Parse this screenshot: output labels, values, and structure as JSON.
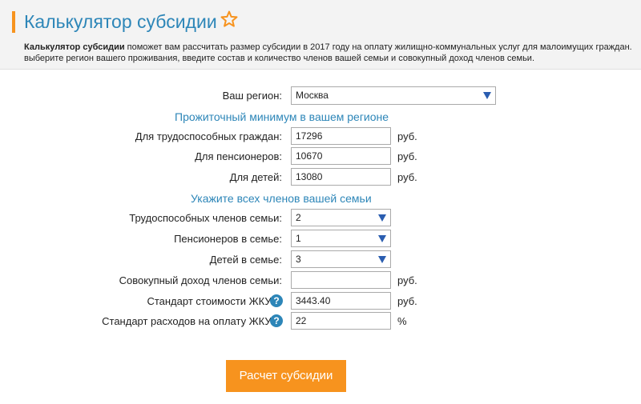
{
  "header": {
    "title": "Калькулятор субсидии",
    "desc_bold": "Калькулятор субсидии",
    "desc_line1_rest": " поможет вам рассчитать размер субсидии в 2017 году на оплату жилищно-коммунальных услуг для малоимущих граждан.",
    "desc_line2": "выберите регион вашего проживания, введите состав и количество членов вашей семьи и совокупный доход членов семьи."
  },
  "region": {
    "label": "Ваш регион:",
    "value": "Москва"
  },
  "minimum": {
    "heading": "Прожиточный минимум в вашем регионе",
    "able_label": "Для трудоспособных граждан:",
    "able_value": "17296",
    "pension_label": "Для пенсионеров:",
    "pension_value": "10670",
    "children_label": "Для детей:",
    "children_value": "13080",
    "unit": "руб."
  },
  "family": {
    "heading": "Укажите всех членов вашей семьи",
    "able_label": "Трудоспособных членов семьи:",
    "able_value": "2",
    "pension_label": "Пенсионеров в семье:",
    "pension_value": "1",
    "children_label": "Детей в семье:",
    "children_value": "3",
    "income_label": "Совокупный доход членов семьи:",
    "income_value": "",
    "standard_label": "Стандарт стоимости ЖКУ:",
    "standard_value": "3443.40",
    "share_label": "Стандарт расходов на оплату ЖКУ:",
    "share_value": "22",
    "unit_rub": "руб.",
    "unit_pct": "%",
    "help": "?"
  },
  "button": {
    "label": "Расчет субсидии"
  },
  "colors": {
    "accent": "#f7931e",
    "title": "#2d86b8",
    "arrow": "#2a5db0"
  },
  "icons": {
    "star": "star-outline-icon",
    "help": "question-circle-icon",
    "dropdown": "triangle-down-icon"
  }
}
